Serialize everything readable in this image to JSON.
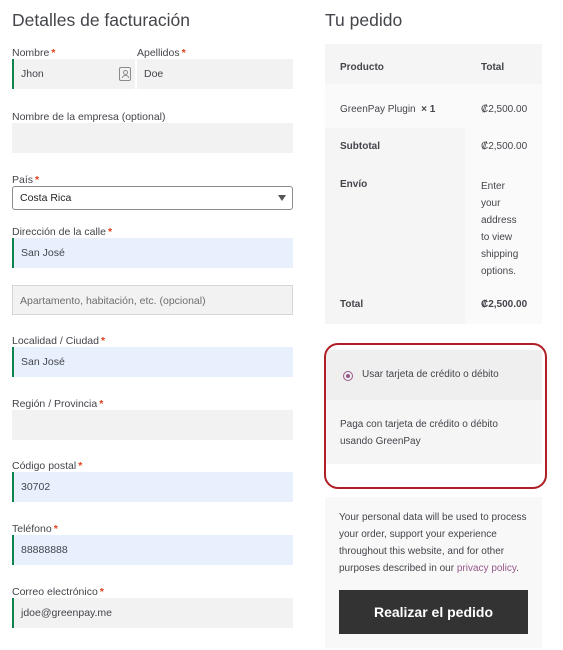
{
  "billing": {
    "title": "Detalles de facturación",
    "required_mark": "*",
    "first_name": {
      "label": "Nombre",
      "value": "Jhon"
    },
    "last_name": {
      "label": "Apellidos",
      "value": "Doe"
    },
    "company": {
      "label": "Nombre de la empresa (optional)",
      "value": ""
    },
    "country": {
      "label": "País",
      "value": "Costa Rica"
    },
    "street": {
      "label": "Dirección de la calle",
      "value": "San José"
    },
    "apartment": {
      "placeholder": "Apartamento, habitación, etc. (opcional)"
    },
    "city": {
      "label": "Localidad / Ciudad",
      "value": "San José"
    },
    "state": {
      "label": "Región / Provincia",
      "value": ""
    },
    "postcode": {
      "label": "Código postal",
      "value": "30702"
    },
    "phone": {
      "label": "Teléfono",
      "value": "88888888"
    },
    "email": {
      "label": "Correo electrónico",
      "value": "jdoe@greenpay.me"
    }
  },
  "order": {
    "title": "Tu pedido",
    "head_product": "Producto",
    "head_total": "Total",
    "item_name": "GreenPay Plugin",
    "item_qty": "× 1",
    "item_total": "₡2,500.00",
    "subtotal_label": "Subtotal",
    "subtotal_value": "₡2,500.00",
    "shipping_label": "Envío",
    "shipping_lines": [
      "Enter",
      "your",
      "address",
      "to view",
      "shipping",
      "options."
    ],
    "total_label": "Total",
    "total_value": "₡2,500.00"
  },
  "payment": {
    "option_label": "Usar tarjeta de crédito o débito",
    "description": "Paga con tarjeta de crédito o débito usando GreenPay",
    "highlight_color": "#b01e26",
    "accent_color": "#96588a"
  },
  "privacy": {
    "text": "Your personal data will be used to process your order, support your experience throughout this website, and for other purposes described in our ",
    "link_text": "privacy policy",
    "suffix": "."
  },
  "place_order": {
    "label": "Realizar el pedido"
  }
}
